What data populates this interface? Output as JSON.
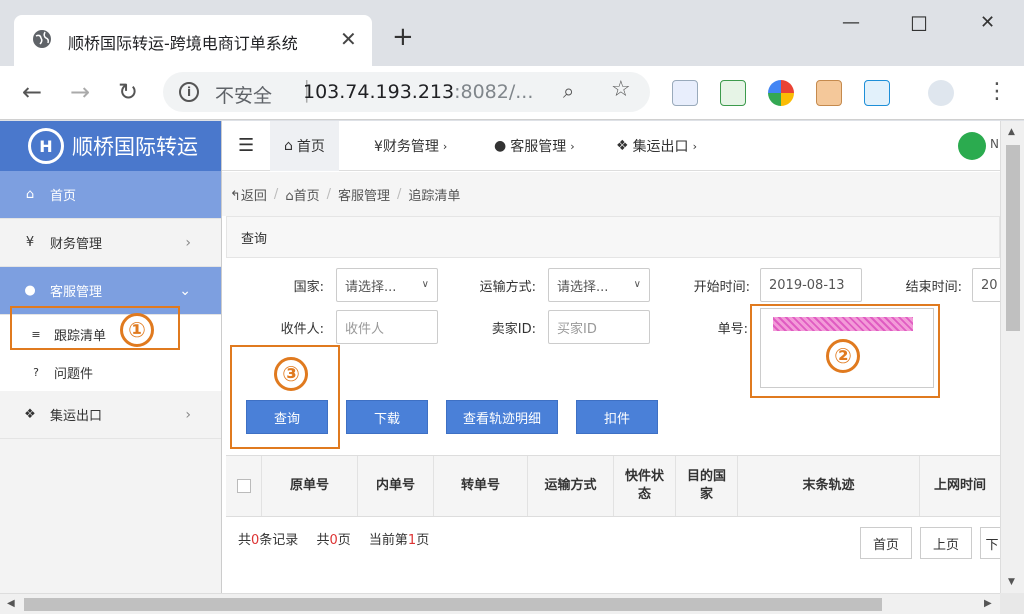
{
  "browser": {
    "tab_title": "顺桥国际转运-跨境电商订单系统",
    "tab_close": "✕",
    "new_tab": "+",
    "insecure_label": "不安全",
    "url_host": "103.74.193.213",
    "url_rest": ":8082/...",
    "window_controls": {
      "minimize": "—",
      "maximize": "☐",
      "close": "✕"
    }
  },
  "sidebar": {
    "brand": "顺桥国际转运",
    "brand_logo": "H",
    "items": [
      {
        "icon": "home-icon",
        "label": "首页"
      },
      {
        "icon": "yen-icon",
        "label": "财务管理",
        "arrow": "›"
      },
      {
        "icon": "user-icon",
        "label": "客服管理",
        "arrow": "⌄"
      },
      {
        "icon": "list-icon",
        "label": "跟踪清单"
      },
      {
        "icon": "question-icon",
        "label": "问题件"
      },
      {
        "icon": "cubes-icon",
        "label": "集运出口",
        "arrow": "›"
      }
    ]
  },
  "topnav": {
    "tabs": [
      {
        "icon": "home-icon",
        "label": "首页",
        "sup": ""
      },
      {
        "icon": "yen-icon",
        "label": "¥财务管理",
        "sup": "›"
      },
      {
        "icon": "user-icon",
        "label": "客服管理",
        "sup": "›"
      },
      {
        "icon": "cubes-icon",
        "label": "集运出口",
        "sup": "›"
      }
    ],
    "user_initial": "N"
  },
  "breadcrumb": {
    "back": "返回",
    "home": "首页",
    "section": "客服管理",
    "current": "追踪清单"
  },
  "query": {
    "panel_title": "查询",
    "country_label": "国家:",
    "country_value": "请选择...",
    "shipping_label": "运输方式:",
    "shipping_value": "请选择...",
    "start_label": "开始时间:",
    "start_value": "2019-08-13",
    "end_label": "结束时间:",
    "end_value": "20",
    "receiver_label": "收件人:",
    "receiver_placeholder": "收件人",
    "seller_label": "卖家ID:",
    "seller_placeholder": "买家ID",
    "tracking_label": "单号:"
  },
  "buttons": {
    "search": "查询",
    "download": "下载",
    "view_track": "查看轨迹明细",
    "hold": "扣件"
  },
  "table": {
    "columns": [
      "原单号",
      "内单号",
      "转单号",
      "运输方式",
      "快件状态",
      "目的国家",
      "末条轨迹",
      "上网时间"
    ]
  },
  "pager": {
    "total_prefix": "共",
    "total_records": "0",
    "total_suffix": "条记录",
    "pages_prefix": "共",
    "pages": "0",
    "pages_suffix": "页",
    "current_prefix": "当前第",
    "current": "1",
    "current_suffix": "页",
    "first": "首页",
    "prev": "上页",
    "next": "下"
  },
  "annotations": [
    "①",
    "②",
    "③"
  ],
  "colors": {
    "brand_blue": "#4a78cc",
    "sidebar_active": "#7d9fe0",
    "button_blue": "#4a80d8",
    "annotation_orange": "#e07a1f"
  }
}
